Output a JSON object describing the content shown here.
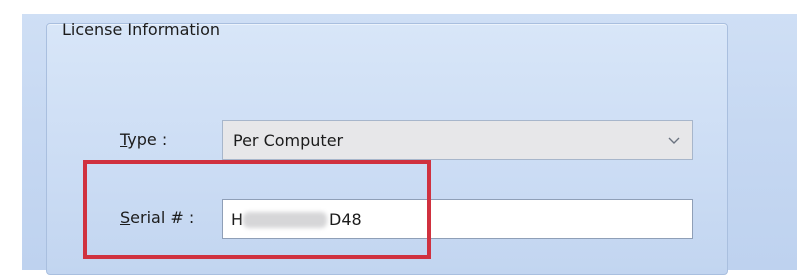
{
  "group": {
    "title": "License Information"
  },
  "fields": {
    "type": {
      "label_mnemonic": "T",
      "label_rest": "ype :",
      "value": "Per Computer",
      "icon": "chevron-down-icon"
    },
    "serial": {
      "label_mnemonic": "S",
      "label_rest": "erial # :",
      "value_start": "H",
      "value_end": "D48",
      "redacted": true
    }
  },
  "annotation": {
    "highlight_color": "#d0313f"
  },
  "colors": {
    "dialog_background": "#c6d8f2",
    "input_background": "#ffffff",
    "select_background": "#e7e7e9"
  }
}
